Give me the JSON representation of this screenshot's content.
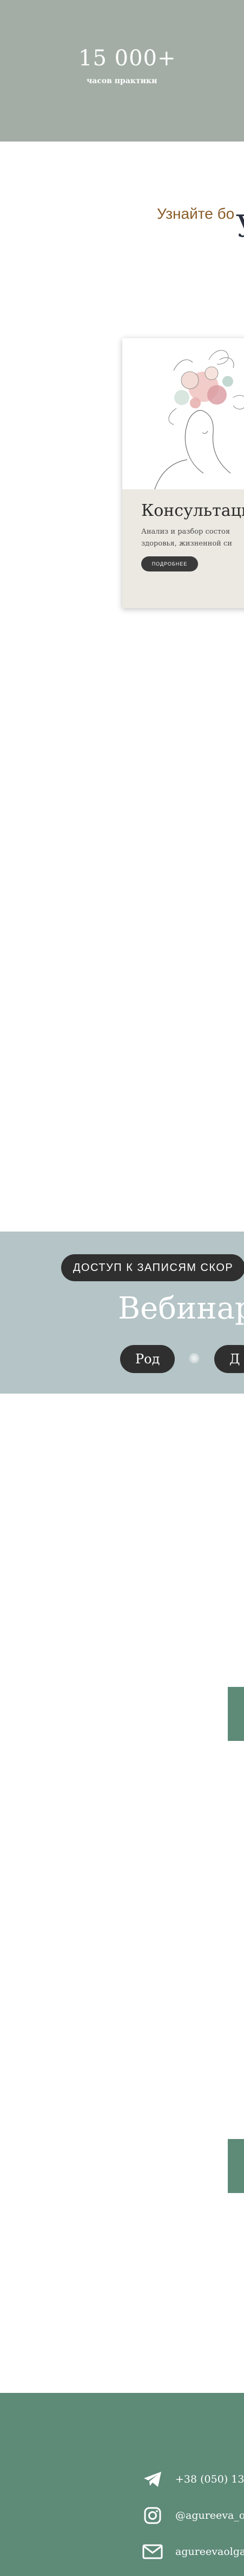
{
  "stats": {
    "number": "15 000+",
    "caption": "часов практики"
  },
  "services": {
    "big_letter": "У",
    "subtitle": "Узнайте бо",
    "card": {
      "title": "Консультаци",
      "description_line1": "Анализ и разбор состоя",
      "description_line2": "здоровья, жизненной си",
      "button_label": "подробнее"
    }
  },
  "webinar": {
    "access_pill": "доступ к записям скор",
    "title": "Вебинар",
    "tags": [
      "Род",
      "Д"
    ],
    "separator_icon": "asterisk-icon"
  },
  "footer": {
    "contacts": [
      {
        "icon": "telegram-icon",
        "text": "+38 (050) 134 0"
      },
      {
        "icon": "instagram-icon",
        "text": "@agureeva_o"
      },
      {
        "icon": "mail-icon",
        "text": "agureevaolga.m"
      }
    ]
  },
  "colors": {
    "stats_bg": "#a3ada5",
    "accent_green": "#5e8a78",
    "webinar_bg": "#b5c4c6",
    "subtitle_brown": "#8a5c2a",
    "dark_pill": "#2f2f2f"
  }
}
